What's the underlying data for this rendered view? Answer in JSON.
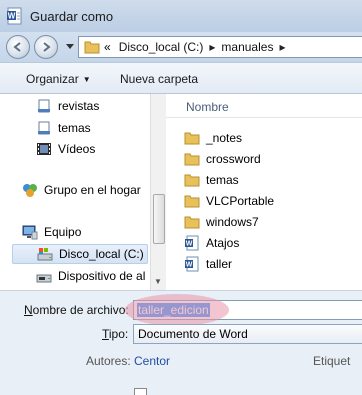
{
  "window": {
    "title": "Guardar como"
  },
  "address": {
    "overflow": "«",
    "segments": [
      "Disco_local (C:)",
      "manuales"
    ]
  },
  "toolbar": {
    "organize_label": "Organizar",
    "new_folder_label": "Nueva carpeta"
  },
  "navpane": {
    "items": [
      {
        "label": "revistas",
        "icon": "document-library-icon"
      },
      {
        "label": "temas",
        "icon": "document-library-icon"
      },
      {
        "label": "Vídeos",
        "icon": "video-library-icon"
      },
      {
        "label": "Grupo en el hogar",
        "icon": "homegroup-icon"
      },
      {
        "label": "Equipo",
        "icon": "computer-icon"
      },
      {
        "label": "Disco_local (C:)",
        "icon": "local-disk-icon",
        "selected": true
      },
      {
        "label": "Dispositivo de al",
        "icon": "storage-device-icon"
      }
    ]
  },
  "files": {
    "column_header": "Nombre",
    "items": [
      {
        "label": "_notes",
        "icon": "folder-icon"
      },
      {
        "label": "crossword",
        "icon": "folder-icon"
      },
      {
        "label": "temas",
        "icon": "folder-icon"
      },
      {
        "label": "VLCPortable",
        "icon": "folder-icon"
      },
      {
        "label": "windows7",
        "icon": "folder-icon"
      },
      {
        "label": "Atajos",
        "icon": "word-document-icon"
      },
      {
        "label": "taller",
        "icon": "word-document-icon"
      }
    ]
  },
  "form": {
    "filename_label_prefix": "N",
    "filename_label_rest": "ombre de archivo:",
    "filename_value": "taller_edicion",
    "type_label_prefix": "T",
    "type_label_rest": "ipo:",
    "type_value": "Documento de Word",
    "authors_label": "Autores:",
    "authors_value": "Centor",
    "tags_label": "Etiquet"
  },
  "colors": {
    "title_bar": "#c5d6ea",
    "selection_blue": "#3399ff",
    "highlight_pink": "#e996aa",
    "link_blue": "#1f4ea8"
  }
}
